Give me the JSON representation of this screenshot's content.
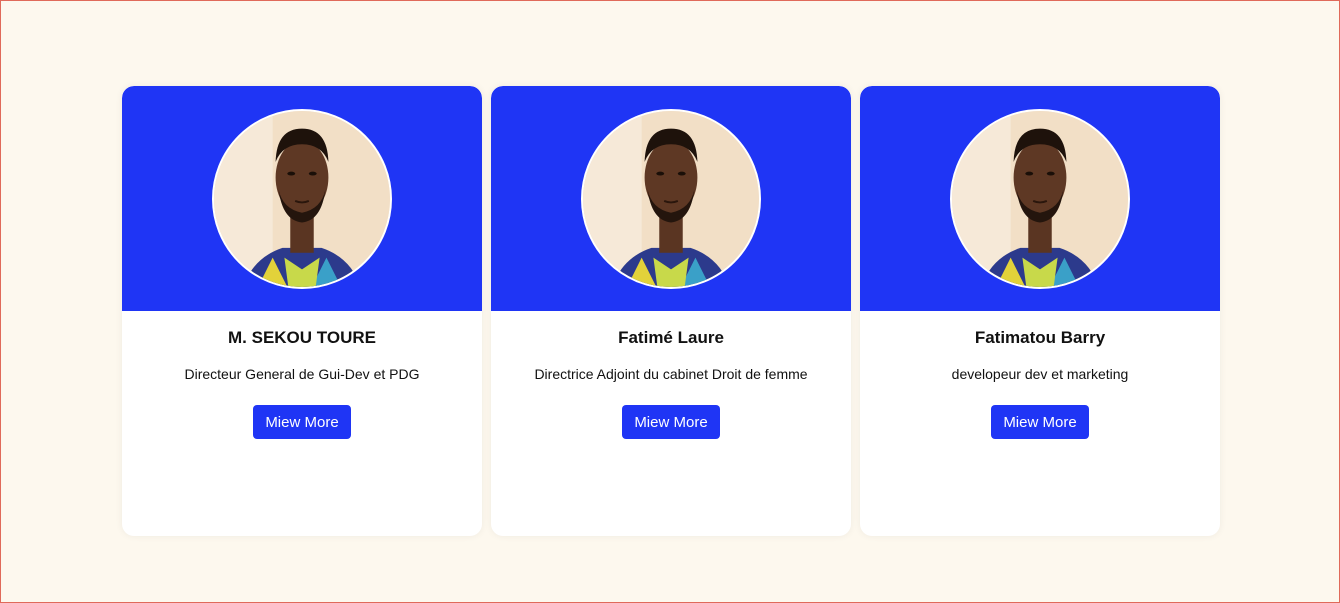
{
  "colors": {
    "accent": "#1f35f5",
    "background": "#fdf8ee",
    "card": "#ffffff"
  },
  "cards": [
    {
      "name": "M. SEKOU TOURE",
      "role": "Directeur General de Gui-Dev et PDG",
      "button_label": "Miew More"
    },
    {
      "name": "Fatimé Laure",
      "role": "Directrice Adjoint du cabinet Droit de femme",
      "button_label": "Miew More"
    },
    {
      "name": "Fatimatou Barry",
      "role": "developeur dev et marketing",
      "button_label": "Miew More"
    }
  ]
}
